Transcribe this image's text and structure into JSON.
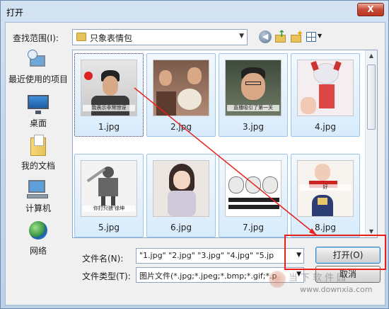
{
  "window": {
    "title": "打开",
    "close_label": "X"
  },
  "toolbar": {
    "lookin_label": "查找范围(I):",
    "lookin_value": "只象表情包",
    "icons": [
      "back-icon",
      "up-folder-icon",
      "new-folder-icon",
      "views-icon"
    ]
  },
  "places": [
    {
      "label": "最近使用的项目",
      "icon": "recent-items-icon"
    },
    {
      "label": "桌面",
      "icon": "desktop-icon"
    },
    {
      "label": "我的文档",
      "icon": "my-documents-icon"
    },
    {
      "label": "计算机",
      "icon": "computer-icon"
    },
    {
      "label": "网络",
      "icon": "network-icon"
    }
  ],
  "files": [
    {
      "name": "1.jpg",
      "caption": "我表示非常惊讶"
    },
    {
      "name": "2.jpg",
      "caption": ""
    },
    {
      "name": "3.jpg",
      "caption": "直播吸引了第一关"
    },
    {
      "name": "4.jpg",
      "caption": ""
    },
    {
      "name": "5.jpg",
      "caption": "你打只狼 徐坤"
    },
    {
      "name": "6.jpg",
      "caption": ""
    },
    {
      "name": "7.jpg",
      "caption": ""
    },
    {
      "name": "8.jpg",
      "caption": "好"
    }
  ],
  "footer": {
    "filename_label": "文件名(N):",
    "filename_value": "\"1.jpg\" \"2.jpg\" \"3.jpg\" \"4.jpg\" \"5.jp",
    "filetype_label": "文件类型(T):",
    "filetype_value": "图片文件(*.jpg;*.jpeg;*.bmp;*.gif;*.p",
    "open_button": "打开(O)",
    "cancel_button": "取消"
  },
  "watermark": {
    "text": "当下软件园",
    "url": "www.downxia.com"
  },
  "colors": {
    "annotation": "#e8201a",
    "titlebar": "#c6d8ec",
    "selection": "#d8ebfb"
  }
}
